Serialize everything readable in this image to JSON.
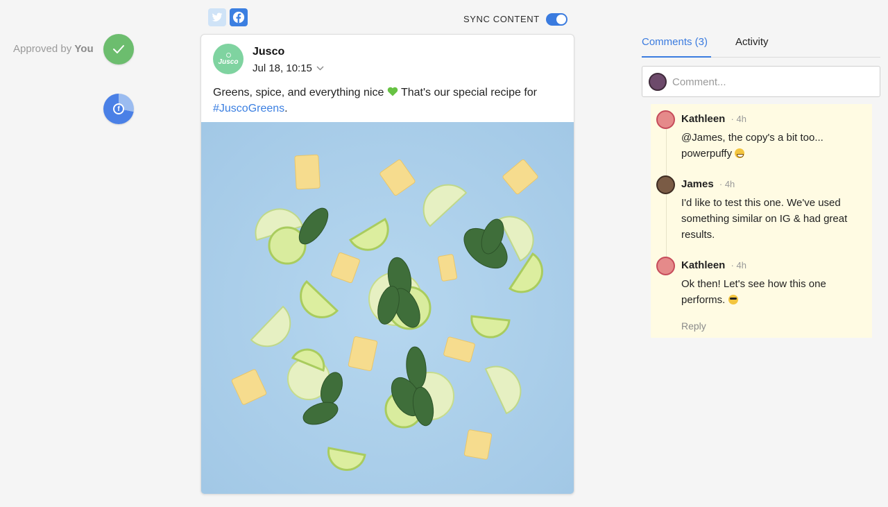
{
  "approval": {
    "prefix": "Approved by",
    "who": "You",
    "status_color": "#6cbd6e"
  },
  "networks": {
    "twitter_icon": "twitter-icon",
    "facebook_icon": "facebook-icon",
    "sync_label": "SYNC CONTENT",
    "sync_on": true
  },
  "post": {
    "brand_name": "Jusco",
    "brand_logo_text": "Jusco",
    "date": "Jul 18, 10:15",
    "text": "Greens, spice, and everything nice",
    "text_after_heart": " That's our special recipe for",
    "hashtag": "#JuscoGreens",
    "hashtag_suffix": "."
  },
  "tabs": {
    "comments": "Comments (3)",
    "activity": "Activity"
  },
  "comment_input": {
    "placeholder": "Comment..."
  },
  "comments": [
    {
      "author": "Kathleen",
      "time": "· 4h",
      "text": "@James, the copy's a bit too... powerpuffy"
    },
    {
      "author": "James",
      "time": "· 4h",
      "text": "I'd like to test this one. We've used something similar on IG & had great results."
    },
    {
      "author": "Kathleen",
      "time": "· 4h",
      "text": "Ok then! Let's see how this one performs."
    }
  ],
  "reply_label": "Reply",
  "colors": {
    "accent": "#3a7bdf",
    "thread_bg": "#fffbe3",
    "photo_bg": "#a9cde9"
  }
}
